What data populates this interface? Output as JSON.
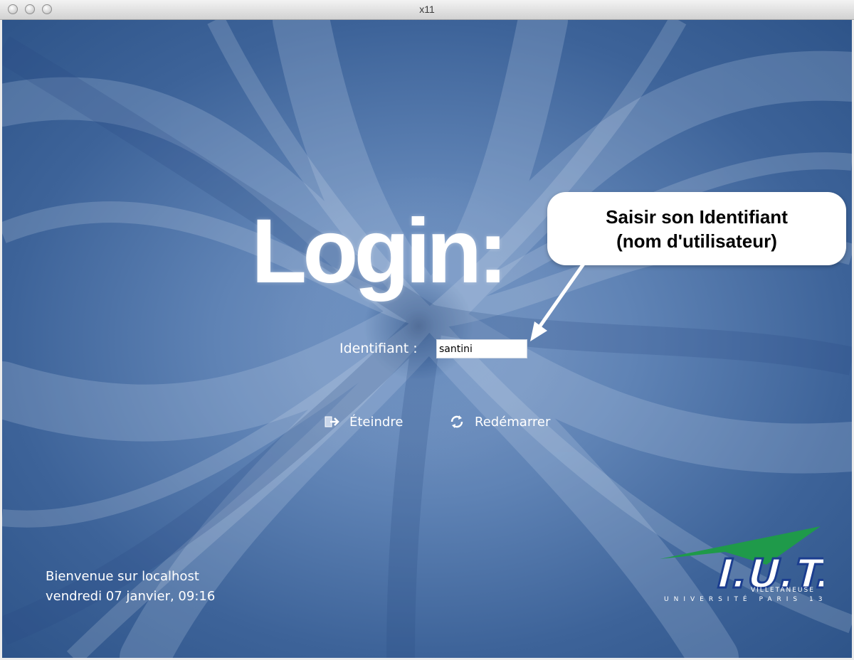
{
  "window": {
    "title": "x11"
  },
  "login": {
    "heading": "Login:",
    "identifier_label": "Identifiant :",
    "identifier_value": "santini"
  },
  "actions": {
    "shutdown_label": "Éteindre",
    "restart_label": "Redémarrer"
  },
  "status": {
    "welcome": "Bienvenue sur localhost",
    "datetime": "vendredi 07 janvier, 09:16"
  },
  "callout": {
    "line1": "Saisir son Identifiant",
    "line2": "(nom d'utilisateur)"
  },
  "logo": {
    "text": "I.U.T.",
    "sub1": "VILLETANEUSE",
    "sub2": "UNIVERSITÉ PARIS 13"
  },
  "colors": {
    "background": "#4f73a8",
    "text": "#ffffff",
    "logo_green": "#1f9a4a",
    "logo_blue": "#1b3d8f"
  }
}
